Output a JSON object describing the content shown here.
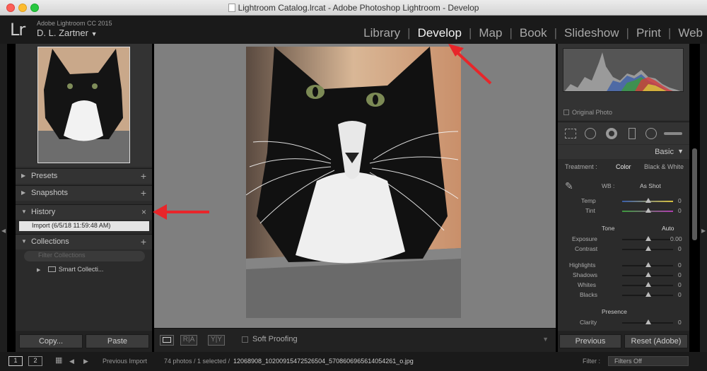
{
  "window": {
    "title": "Lightroom Catalog.lrcat - Adobe Photoshop Lightroom - Develop"
  },
  "identity": {
    "logo": "Lr",
    "product": "Adobe Lightroom CC 2015",
    "user": "D. L. Zartner",
    "user_caret": "▼"
  },
  "modules": [
    {
      "label": "Library"
    },
    {
      "label": "Develop"
    },
    {
      "label": "Map"
    },
    {
      "label": "Book"
    },
    {
      "label": "Slideshow"
    },
    {
      "label": "Print"
    },
    {
      "label": "Web"
    }
  ],
  "left_panel": {
    "presets": "Presets",
    "snapshots": "Snapshots",
    "history": "History",
    "history_item": "Import (6/5/18 11:59:48 AM)",
    "collections": "Collections",
    "filter_placeholder": "Filter Collections",
    "smart_collections": "Smart Collecti...",
    "copy_btn": "Copy...",
    "paste_btn": "Paste"
  },
  "toolbar": {
    "ra": "R|A",
    "yy": "Y|Y",
    "soft_proofing": "Soft Proofing"
  },
  "right_panel": {
    "original_photo": "Original Photo",
    "basic": "Basic",
    "treatment_label": "Treatment :",
    "color": "Color",
    "bw": "Black & White",
    "wb_label": "WB :",
    "wb_value": "As Shot",
    "temp": "Temp",
    "temp_val": "0",
    "tint": "Tint",
    "tint_val": "0",
    "tone": "Tone",
    "auto": "Auto",
    "exposure": "Exposure",
    "exposure_val": "0.00",
    "contrast": "Contrast",
    "contrast_val": "0",
    "highlights": "Highlights",
    "highlights_val": "0",
    "shadows": "Shadows",
    "shadows_val": "0",
    "whites": "Whites",
    "whites_val": "0",
    "blacks": "Blacks",
    "blacks_val": "0",
    "presence": "Presence",
    "clarity": "Clarity",
    "clarity_val": "0",
    "previous_btn": "Previous",
    "reset_btn": "Reset (Adobe)"
  },
  "filmstrip": {
    "page1": "1",
    "page2": "2",
    "source": "Previous Import",
    "info": "74 photos / 1 selected /",
    "filename": "12068908_10200915472526504_5708606965614054261_o.jpg",
    "filter_label": "Filter :",
    "filter_value": "Filters Off"
  },
  "colors": {
    "annotation_arrow": "#e8262a",
    "panel": "#2b2b2b",
    "background": "#7f7f7f"
  }
}
